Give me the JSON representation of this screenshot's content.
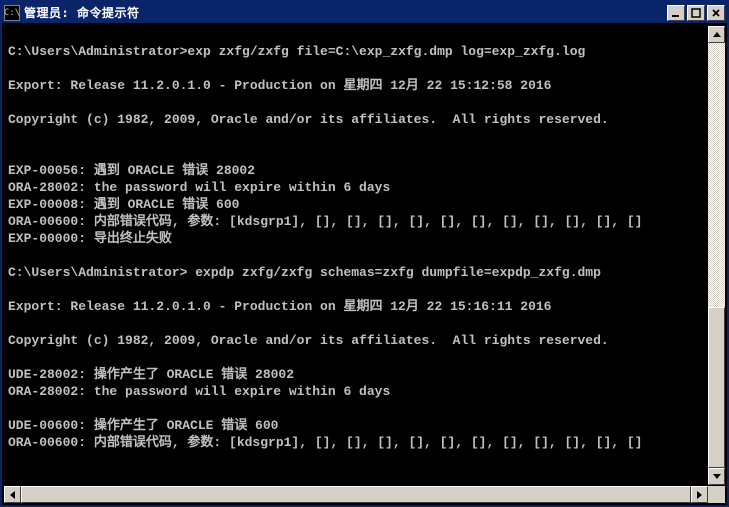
{
  "window": {
    "icon_text": "C:\\",
    "title": "管理员: 命令提示符"
  },
  "terminal": {
    "lines": [
      "",
      "C:\\Users\\Administrator>exp zxfg/zxfg file=C:\\exp_zxfg.dmp log=exp_zxfg.log",
      "",
      "Export: Release 11.2.0.1.0 - Production on 星期四 12月 22 15:12:58 2016",
      "",
      "Copyright (c) 1982, 2009, Oracle and/or its affiliates.  All rights reserved.",
      "",
      "",
      "EXP-00056: 遇到 ORACLE 错误 28002",
      "ORA-28002: the password will expire within 6 days",
      "EXP-00008: 遇到 ORACLE 错误 600",
      "ORA-00600: 内部错误代码, 参数: [kdsgrp1], [], [], [], [], [], [], [], [], [], [], []",
      "EXP-00000: 导出终止失败",
      "",
      "C:\\Users\\Administrator> expdp zxfg/zxfg schemas=zxfg dumpfile=expdp_zxfg.dmp",
      "",
      "Export: Release 11.2.0.1.0 - Production on 星期四 12月 22 15:16:11 2016",
      "",
      "Copyright (c) 1982, 2009, Oracle and/or its affiliates.  All rights reserved.",
      "",
      "UDE-28002: 操作产生了 ORACLE 错误 28002",
      "ORA-28002: the password will expire within 6 days",
      "",
      "UDE-00600: 操作产生了 ORACLE 错误 600",
      "ORA-00600: 内部错误代码, 参数: [kdsgrp1], [], [], [], [], [], [], [], [], [], [], []",
      "",
      ""
    ],
    "prompt": "C:\\Users\\Administrator>"
  },
  "scrollbar": {
    "v_thumb_top_pct": 62,
    "v_thumb_height_pct": 38,
    "h_thumb_left_pct": 0,
    "h_thumb_width_pct": 100
  }
}
